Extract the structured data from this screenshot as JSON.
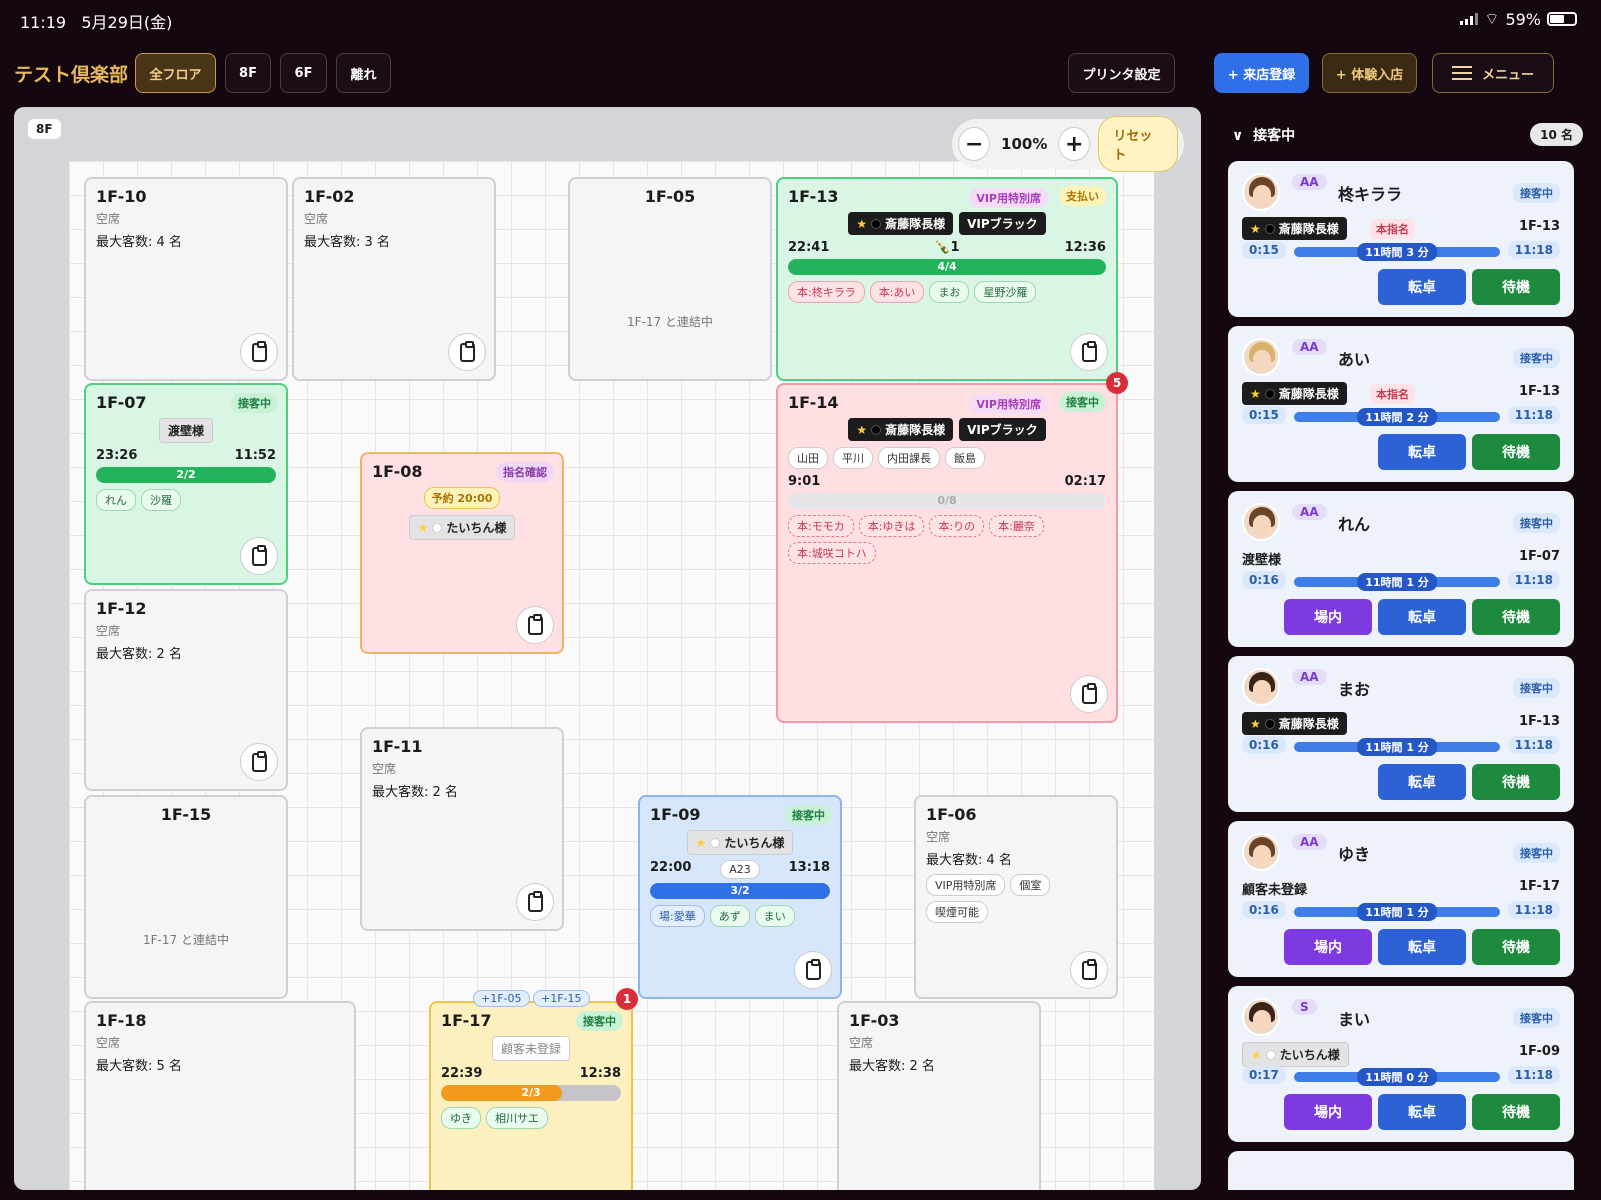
{
  "status": {
    "time": "11:19",
    "date": "5月29日(金)",
    "battery": "59%"
  },
  "header": {
    "brand": "テスト倶楽部",
    "tabs": [
      "全フロア",
      "8F",
      "6F",
      "離れ"
    ],
    "printer": "プリンタ設定",
    "register": "+ 来店登録",
    "trial": "+ 体験入店",
    "menu": "メニュー"
  },
  "floor": {
    "tag": "8F",
    "zoom": "100%",
    "zoom_minus": "−",
    "zoom_plus": "+",
    "reset": "リセット"
  },
  "tables": {
    "t1f10": {
      "id": "1F-10",
      "status": "空席",
      "cap": "最大客数: 4 名"
    },
    "t1f02": {
      "id": "1F-02",
      "status": "空席",
      "cap": "最大客数: 3 名"
    },
    "t1f05": {
      "id": "1F-05",
      "merge": "1F-17 と連結中"
    },
    "t1f13": {
      "id": "1F-13",
      "vip": "VIP用特別席",
      "pay": "支払い",
      "guest": "斎藤隊長様",
      "guest_tag": "VIPブラック",
      "start": "22:41",
      "bottle": "🍾1",
      "end": "12:36",
      "bar": "4/4",
      "chips": [
        "本:柊キララ",
        "本:あい",
        "まお",
        "星野沙羅"
      ]
    },
    "t1f07": {
      "id": "1F-07",
      "serve": "接客中",
      "guest": "渡壁様",
      "start": "23:26",
      "end": "11:52",
      "bar": "2/2",
      "chips": [
        "れん",
        "沙羅"
      ]
    },
    "t1f14": {
      "id": "1F-14",
      "vip": "VIP用特別席",
      "serve": "接客中",
      "guest": "斎藤隊長様",
      "guest_tag": "VIPブラック",
      "names": [
        "山田",
        "平川",
        "内田課長",
        "飯島"
      ],
      "start": "9:01",
      "end": "02:17",
      "bar": "0/8",
      "chips": [
        "本:モモカ",
        "本:ゆきは",
        "本:りの",
        "本:麗奈",
        "本:城咲コトハ"
      ],
      "notif": "5"
    },
    "t1f08": {
      "id": "1F-08",
      "nom": "指名確認",
      "reserve": "予約 20:00",
      "guest": "たいちん様"
    },
    "t1f12": {
      "id": "1F-12",
      "status": "空席",
      "cap": "最大客数: 2 名"
    },
    "t1f11": {
      "id": "1F-11",
      "status": "空席",
      "cap": "最大客数: 2 名"
    },
    "t1f15": {
      "id": "1F-15",
      "merge": "1F-17 と連結中"
    },
    "t1f09": {
      "id": "1F-09",
      "serve": "接客中",
      "guest": "たいちん様",
      "start": "22:00",
      "code": "A23",
      "end": "13:18",
      "bar": "3/2",
      "chips": [
        "場:愛華",
        "あず",
        "まい"
      ]
    },
    "t1f06": {
      "id": "1F-06",
      "status": "空席",
      "cap": "最大客数: 4 名",
      "chips": [
        "VIP用特別席",
        "個室",
        "喫煙可能"
      ]
    },
    "t1f18": {
      "id": "1F-18",
      "status": "空席",
      "cap": "最大客数: 5 名"
    },
    "t1f17": {
      "id": "1F-17",
      "serve": "接客中",
      "guest": "顧客未登録",
      "start": "22:39",
      "end": "12:38",
      "bar": "2/3",
      "chips": [
        "ゆき",
        "相川サエ"
      ],
      "conn": [
        "+1F-05",
        "+1F-15"
      ],
      "notif": "1"
    },
    "t1f03": {
      "id": "1F-03",
      "status": "空席",
      "cap": "最大客数: 2 名"
    }
  },
  "side": {
    "head": "接客中",
    "count": "10 名",
    "staff": [
      {
        "rank": "AA",
        "name": "柊キララ",
        "status": "接客中",
        "guest": "斎藤隊長様",
        "nom": "本指名",
        "table": "1F-13",
        "t0": "0:15",
        "elapsed": "11時間 3 分",
        "t1": "11:18",
        "b2": "転卓",
        "b3": "待機"
      },
      {
        "rank": "AA",
        "name": "あい",
        "status": "接客中",
        "guest": "斎藤隊長様",
        "nom": "本指名",
        "table": "1F-13",
        "t0": "0:15",
        "elapsed": "11時間 2 分",
        "t1": "11:18",
        "b2": "転卓",
        "b3": "待機"
      },
      {
        "rank": "AA",
        "name": "れん",
        "status": "接客中",
        "guest": "渡壁様",
        "table": "1F-07",
        "t0": "0:16",
        "elapsed": "11時間 1 分",
        "t1": "11:18",
        "b1": "場内",
        "b2": "転卓",
        "b3": "待機"
      },
      {
        "rank": "AA",
        "name": "まお",
        "status": "接客中",
        "guest": "斎藤隊長様",
        "table": "1F-13",
        "t0": "0:16",
        "elapsed": "11時間 1 分",
        "t1": "11:18",
        "b2": "転卓",
        "b3": "待機"
      },
      {
        "rank": "AA",
        "name": "ゆき",
        "status": "接客中",
        "guest": "顧客未登録",
        "table": "1F-17",
        "t0": "0:16",
        "elapsed": "11時間 1 分",
        "t1": "11:18",
        "b1": "場内",
        "b2": "転卓",
        "b3": "待機"
      },
      {
        "rank": "S",
        "name": "まい",
        "status": "接客中",
        "guest": "たいちん様",
        "table": "1F-09",
        "t0": "0:17",
        "elapsed": "11時間 0 分",
        "t1": "11:18",
        "b1": "場内",
        "b2": "転卓",
        "b3": "待機"
      }
    ]
  }
}
